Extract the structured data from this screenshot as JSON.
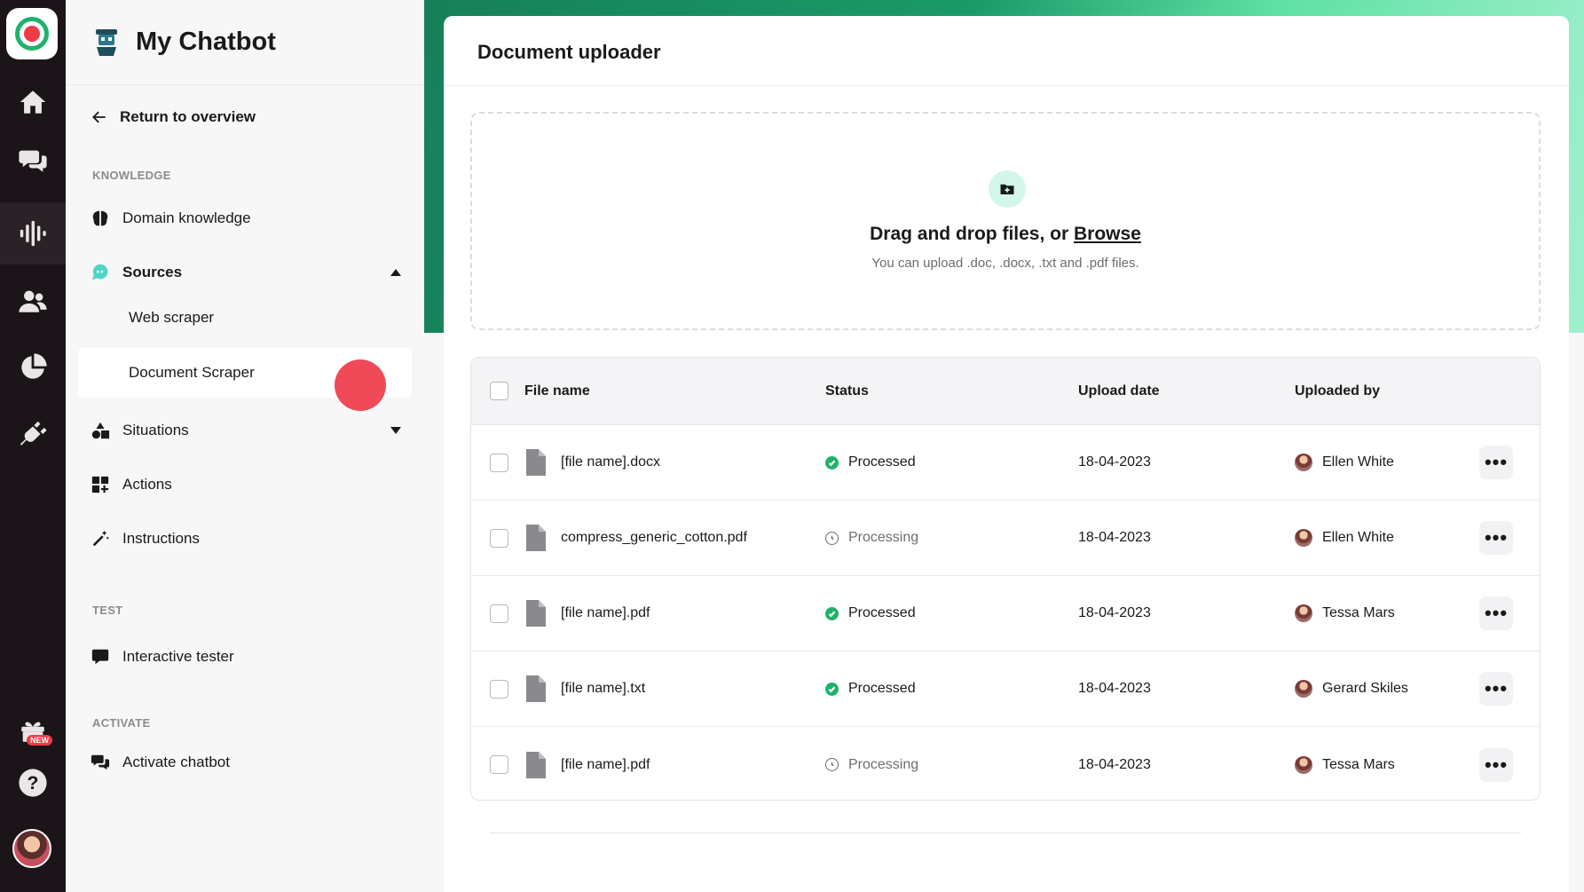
{
  "app": {
    "title": "My Chatbot"
  },
  "rail": {
    "items": [
      {
        "icon": "home-icon"
      },
      {
        "icon": "chat-bubbles-icon"
      },
      {
        "icon": "voice-bars-icon"
      },
      {
        "icon": "users-icon"
      },
      {
        "icon": "pie-chart-icon"
      },
      {
        "icon": "plug-icon"
      }
    ],
    "gift_badge": "NEW",
    "help_label": "?"
  },
  "sidebar": {
    "return_label": "Return to overview",
    "sections": {
      "knowledge": "KNOWLEDGE",
      "test": "TEST",
      "activate": "ACTIVATE"
    },
    "items": {
      "domain_knowledge": "Domain knowledge",
      "sources": "Sources",
      "web_scraper": "Web scraper",
      "document_scraper": "Document Scraper",
      "situations": "Situations",
      "actions": "Actions",
      "instructions": "Instructions",
      "interactive_tester": "Interactive tester",
      "activate_chatbot": "Activate chatbot"
    }
  },
  "main": {
    "title": "Document uploader",
    "dropzone": {
      "prefix": "Drag and drop files, or",
      "browse": "Browse",
      "hint": "You can upload .doc, .docx, .txt and .pdf files."
    },
    "table": {
      "headers": {
        "file_name": "File name",
        "status": "Status",
        "upload_date": "Upload date",
        "uploaded_by": "Uploaded by"
      },
      "rows": [
        {
          "file": "[file name].docx",
          "status": "Processed",
          "state": "ok",
          "date": "18-04-2023",
          "user": "Ellen White"
        },
        {
          "file": "compress_generic_cotton.pdf",
          "status": "Processing",
          "state": "wait",
          "date": "18-04-2023",
          "user": "Ellen White"
        },
        {
          "file": "[file name].pdf",
          "status": "Processed",
          "state": "ok",
          "date": "18-04-2023",
          "user": "Tessa Mars"
        },
        {
          "file": "[file name].txt",
          "status": "Processed",
          "state": "ok",
          "date": "18-04-2023",
          "user": "Gerard Skiles"
        },
        {
          "file": "[file name].pdf",
          "status": "Processing",
          "state": "wait",
          "date": "18-04-2023",
          "user": "Tessa Mars"
        }
      ],
      "more_label": "•••"
    }
  },
  "colors": {
    "accent": "#20b26b",
    "rail_bg": "#1b1418",
    "cursor": "#ef4050"
  }
}
